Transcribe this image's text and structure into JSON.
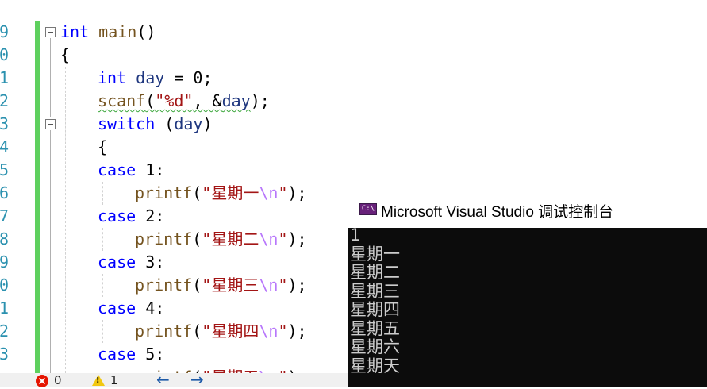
{
  "editor": {
    "line_numbers": [
      "9",
      "0",
      "1",
      "2",
      "3",
      "4",
      "5",
      "6",
      "7",
      "8",
      "9",
      "0",
      "1",
      "2",
      "3"
    ],
    "lines": [
      {
        "t": [
          [
            "kw",
            "int"
          ],
          [
            "",
            " "
          ],
          [
            "fn",
            "main"
          ],
          [
            "",
            "()"
          ]
        ]
      },
      {
        "t": [
          [
            "",
            "{"
          ]
        ]
      },
      {
        "t": [
          [
            "kw",
            "int"
          ],
          [
            "",
            " "
          ],
          [
            "var",
            "day"
          ],
          [
            "",
            " = 0;"
          ]
        ]
      },
      {
        "t": [
          [
            "fn sq",
            "scanf"
          ],
          [
            "sq",
            "("
          ],
          [
            "str sq",
            "\"%d\""
          ],
          [
            "sq",
            ", &"
          ],
          [
            "var sq",
            "day"
          ],
          [
            "",
            ");"
          ]
        ]
      },
      {
        "t": [
          [
            "kw",
            "switch"
          ],
          [
            "",
            " ("
          ],
          [
            "var",
            "day"
          ],
          [
            "",
            ")"
          ]
        ]
      },
      {
        "t": [
          [
            "",
            "{"
          ]
        ]
      },
      {
        "t": [
          [
            "kw",
            "case"
          ],
          [
            "",
            " 1:"
          ]
        ]
      },
      {
        "t": [
          [
            "fn",
            "printf"
          ],
          [
            "",
            "("
          ],
          [
            "str",
            "\"星期一"
          ],
          [
            "esc",
            "\\n"
          ],
          [
            "str",
            "\""
          ],
          [
            "",
            ");"
          ]
        ]
      },
      {
        "t": [
          [
            "kw",
            "case"
          ],
          [
            "",
            " 2:"
          ]
        ]
      },
      {
        "t": [
          [
            "fn",
            "printf"
          ],
          [
            "",
            "("
          ],
          [
            "str",
            "\"星期二"
          ],
          [
            "esc",
            "\\n"
          ],
          [
            "str",
            "\""
          ],
          [
            "",
            ");"
          ]
        ]
      },
      {
        "t": [
          [
            "kw",
            "case"
          ],
          [
            "",
            " 3:"
          ]
        ]
      },
      {
        "t": [
          [
            "fn",
            "printf"
          ],
          [
            "",
            "("
          ],
          [
            "str",
            "\"星期三"
          ],
          [
            "esc",
            "\\n"
          ],
          [
            "str",
            "\""
          ],
          [
            "",
            ");"
          ]
        ]
      },
      {
        "t": [
          [
            "kw",
            "case"
          ],
          [
            "",
            " 4:"
          ]
        ]
      },
      {
        "t": [
          [
            "fn",
            "printf"
          ],
          [
            "",
            "("
          ],
          [
            "str",
            "\"星期四"
          ],
          [
            "esc",
            "\\n"
          ],
          [
            "str",
            "\""
          ],
          [
            "",
            ");"
          ]
        ]
      },
      {
        "t": [
          [
            "kw",
            "case"
          ],
          [
            "",
            " 5:"
          ]
        ]
      },
      {
        "t": [
          [
            "fn",
            "printf"
          ],
          [
            "",
            "("
          ],
          [
            "str",
            "\"星期五"
          ],
          [
            "esc",
            "\\n"
          ],
          [
            "str",
            "\""
          ],
          [
            "",
            ");"
          ]
        ]
      }
    ]
  },
  "status_bar": {
    "errors": "0",
    "warnings": "1",
    "nav_back": "←",
    "nav_forward": "→"
  },
  "console": {
    "icon_text": "C:\\",
    "title": "Microsoft Visual Studio 调试控制台",
    "output": [
      "1",
      "星期一",
      "星期二",
      "星期三",
      "星期四",
      "星期五",
      "星期六",
      "星期天"
    ]
  }
}
